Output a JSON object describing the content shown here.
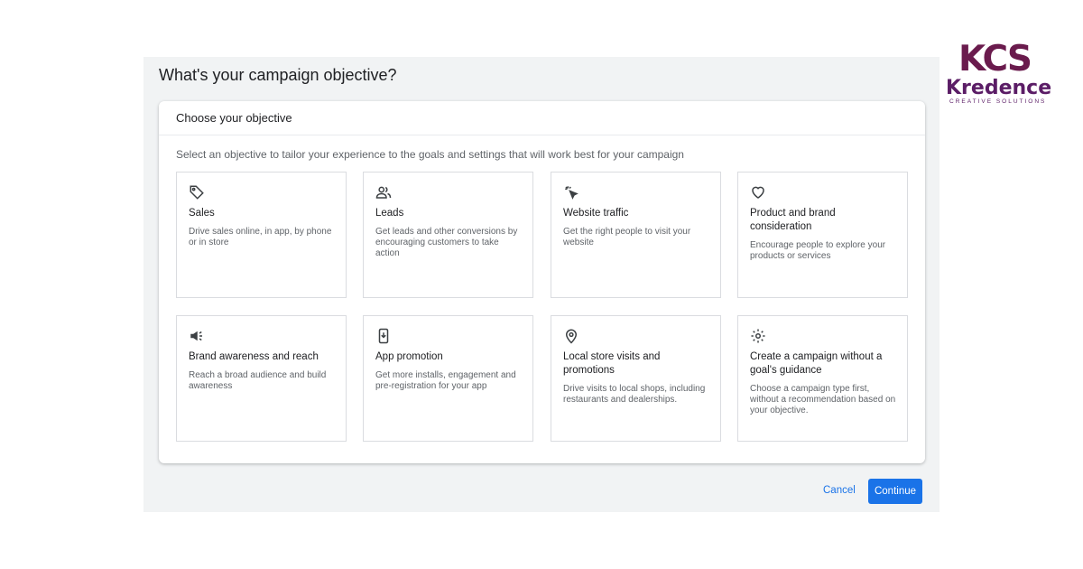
{
  "title": "What's your campaign objective?",
  "card": {
    "header": "Choose your objective",
    "subtitle": "Select an objective to tailor your experience to the goals and settings that will work best for your campaign"
  },
  "objectives": [
    {
      "icon": "tag-icon",
      "title": "Sales",
      "description": "Drive sales online, in app, by phone or in store"
    },
    {
      "icon": "people-icon",
      "title": "Leads",
      "description": "Get leads and other conversions by encouraging customers to take action"
    },
    {
      "icon": "cursor-click-icon",
      "title": "Website traffic",
      "description": "Get the right people to visit your website"
    },
    {
      "icon": "heart-icon",
      "title": "Product and brand consideration",
      "description": "Encourage people to explore your products or services"
    },
    {
      "icon": "speaker-icon",
      "title": "Brand awareness and reach",
      "description": "Reach a broad audience and build awareness"
    },
    {
      "icon": "phone-download-icon",
      "title": "App promotion",
      "description": "Get more installs, engagement and pre-registration for your app"
    },
    {
      "icon": "location-pin-icon",
      "title": "Local store visits and promotions",
      "description": "Drive visits to local shops, including restaurants and dealerships."
    },
    {
      "icon": "gear-icon",
      "title": "Create a campaign without a goal's guidance",
      "description": "Choose a campaign type first, without a recommendation based on your objective."
    }
  ],
  "actions": {
    "cancel": "Cancel",
    "continue": "Continue"
  },
  "logo": {
    "mark": "KCS",
    "word": "Kredence",
    "tagline": "CREATIVE SOLUTIONS"
  },
  "colors": {
    "accent": "#1a73e8",
    "brand": "#5b1d66",
    "panel_bg": "#f1f3f4"
  }
}
